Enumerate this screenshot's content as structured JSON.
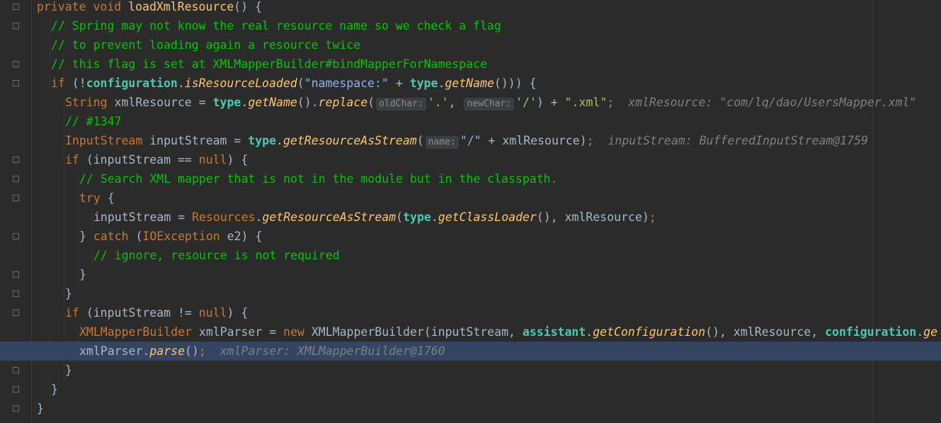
{
  "editor": {
    "lines": [
      {
        "id": "l1"
      },
      {
        "id": "l2"
      }
    ],
    "code": {
      "l1_kw": "private void ",
      "l1_fn": "loadXmlResource",
      "l1_rest": "() {",
      "l2": "// Spring may not know the real resource name so we check a flag",
      "l3": "// to prevent loading again a resource twice",
      "l4": "// this flag is set at XMLMapperBuilder#bindMapperForNamespace",
      "l5_if": "if ",
      "l5_a": "(!",
      "l5_cfg": "configuration",
      "l5_dot": ".",
      "l5_m": "isResourceLoaded",
      "l5_b": "(",
      "l5_s": "\"namespace:\"",
      "l5_c": " + ",
      "l5_t": "type",
      "l5_d": ".",
      "l5_m2": "getName",
      "l5_e": "())) {",
      "l6_type": "String ",
      "l6_var": "xmlResource = ",
      "l6_t": "type",
      "l6_d": ".",
      "l6_m": "getName",
      "l6_e": "().",
      "l6_m2": "replace",
      "l6_p": "(",
      "l6_h1": "oldChar:",
      "l6_s1": "'.'",
      "l6_comma": ", ",
      "l6_h2": "newChar:",
      "l6_s2": "'/'",
      "l6_f": ") + ",
      "l6_s3": "\".xml\"",
      "l6_semi": ";",
      "l6_inl": "xmlResource: \"com/lq/dao/UsersMapper.xml\"",
      "l7": "// #1347",
      "l8_type": "InputStream ",
      "l8_var": "inputStream = ",
      "l8_t": "type",
      "l8_d": ".",
      "l8_m": "getResourceAsStream",
      "l8_p": "(",
      "l8_h": "name:",
      "l8_s": "\"/\"",
      "l8_e": " + xmlResource)",
      "l8_semi": ";",
      "l8_inl": "inputStream: BufferedInputStream@1759",
      "l9_if": "if ",
      "l9_a": "(inputStream == ",
      "l9_null": "null",
      "l9_e": ") {",
      "l10": "// Search XML mapper that is not in the module but in the classpath.",
      "l11_try": "try ",
      "l11_e": "{",
      "l12_a": "inputStream = ",
      "l12_cls": "Resources",
      "l12_d": ".",
      "l12_m": "getResourceAsStream",
      "l12_p": "(",
      "l12_t": "type",
      "l12_d2": ".",
      "l12_m2": "getClassLoader",
      "l12_e": "(), xmlResource)",
      "l12_semi": ";",
      "l13_a": "} ",
      "l13_catch": "catch ",
      "l13_p": "(",
      "l13_cls": "IOException",
      "l13_e": " e2) {",
      "l14": "// ignore, resource is not required",
      "l15": "}",
      "l16": "}",
      "l17_if": "if ",
      "l17_a": "(inputStream != ",
      "l17_null": "null",
      "l17_e": ") {",
      "l18_cls": "XMLMapperBuilder ",
      "l18_var": "xmlParser = ",
      "l18_new": "new ",
      "l18_c2": "XMLMapperBuilder",
      "l18_p": "(inputStream, ",
      "l18_as": "assistant",
      "l18_d": ".",
      "l18_m": "getConfiguration",
      "l18_e": "(), xmlResource, ",
      "l18_cfg": "configuration",
      "l18_d2": ".",
      "l18_tail": "ge",
      "l19_a": "xmlParser.",
      "l19_m": "parse",
      "l19_e": "()",
      "l19_semi": ";",
      "l19_inl": "xmlParser: XMLMapperBuilder@1760",
      "l20": "}",
      "l21": "}",
      "l22": "}"
    }
  }
}
